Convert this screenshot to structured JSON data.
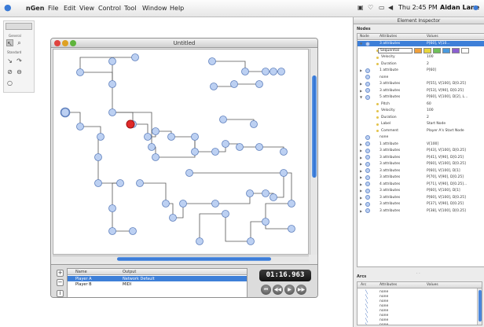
{
  "menubar": {
    "apple_glyph": "",
    "app_name": "nGen",
    "items": [
      "File",
      "Edit",
      "View",
      "Control",
      "Tool",
      "Window",
      "Help"
    ],
    "clock": "Thu 2:45 PM",
    "user": "Aidan Lane"
  },
  "palette": {
    "sections": [
      "General",
      "Standard"
    ]
  },
  "main_window": {
    "title": "Untitled",
    "players_header": [
      "Name",
      "Output"
    ],
    "players": [
      {
        "name": "Player A",
        "output": "Network Default",
        "selected": true
      },
      {
        "name": "Player B",
        "output": "MIDI",
        "selected": false
      }
    ],
    "timer": "01:16.963",
    "transport": [
      "rewind",
      "fast-rewind",
      "play",
      "fast-forward"
    ],
    "add_label": "+",
    "remove_label": "−",
    "info_label": "i"
  },
  "inspector": {
    "title": "Element Inspector",
    "nodes_label": "Nodes",
    "nodes_header": [
      "Node",
      "Attributes",
      "Values"
    ],
    "nodes": [
      {
        "disc": "▼",
        "attr": "3 attributes",
        "value": "P[60], V[10...",
        "selected": true,
        "sub": false
      },
      {
        "disc": "",
        "attr": "Sequential",
        "value": "",
        "selected": false,
        "sub": true,
        "popup": true
      },
      {
        "disc": "",
        "attr": "Velocity",
        "value": "100",
        "selected": false,
        "sub": true
      },
      {
        "disc": "",
        "attr": "Duration",
        "value": "2",
        "selected": false,
        "sub": true
      },
      {
        "disc": "▶",
        "attr": "1 attribute",
        "value": "P[60]",
        "selected": false,
        "sub": false
      },
      {
        "disc": "",
        "attr": "none",
        "value": "",
        "selected": false,
        "sub": false
      },
      {
        "disc": "▶",
        "attr": "3 attributes",
        "value": "P[55], V[100], D[0.25]",
        "selected": false,
        "sub": false
      },
      {
        "disc": "▶",
        "attr": "3 attributes",
        "value": "P[53], V[90], D[0.25]",
        "selected": false,
        "sub": false
      },
      {
        "disc": "▼",
        "attr": "5 attributes",
        "value": "P[60], V[100], D[2], L...",
        "selected": false,
        "sub": false
      },
      {
        "disc": "",
        "attr": "Pitch",
        "value": "60",
        "selected": false,
        "sub": true
      },
      {
        "disc": "",
        "attr": "Velocity",
        "value": "100",
        "selected": false,
        "sub": true
      },
      {
        "disc": "",
        "attr": "Duration",
        "value": "2",
        "selected": false,
        "sub": true
      },
      {
        "disc": "",
        "attr": "Label",
        "value": "Start Node",
        "selected": false,
        "sub": true
      },
      {
        "disc": "",
        "attr": "Comment",
        "value": "Player A's Start Node",
        "selected": false,
        "sub": true
      },
      {
        "disc": "",
        "attr": "none",
        "value": "",
        "selected": false,
        "sub": false
      },
      {
        "disc": "▶",
        "attr": "1 attribute",
        "value": "V[100]",
        "selected": false,
        "sub": false
      },
      {
        "disc": "▶",
        "attr": "3 attributes",
        "value": "P[43], V[100], D[0.25]",
        "selected": false,
        "sub": false
      },
      {
        "disc": "▶",
        "attr": "3 attributes",
        "value": "P[41], V[90], D[0.25]",
        "selected": false,
        "sub": false
      },
      {
        "disc": "▶",
        "attr": "3 attributes",
        "value": "P[60], V[100], D[0.25]",
        "selected": false,
        "sub": false
      },
      {
        "disc": "▶",
        "attr": "3 attributes",
        "value": "P[60], V[100], D[1]",
        "selected": false,
        "sub": false
      },
      {
        "disc": "▶",
        "attr": "3 attributes",
        "value": "P[70], V[90], D[0.25]",
        "selected": false,
        "sub": false
      },
      {
        "disc": "▶",
        "attr": "4 attributes",
        "value": "P[71], V[90], D[0.25]...",
        "selected": false,
        "sub": false
      },
      {
        "disc": "▶",
        "attr": "3 attributes",
        "value": "P[60], V[100], D[1]",
        "selected": false,
        "sub": false
      },
      {
        "disc": "▶",
        "attr": "3 attributes",
        "value": "P[60], V[100], D[0.25]",
        "selected": false,
        "sub": false
      },
      {
        "disc": "▶",
        "attr": "3 attributes",
        "value": "P[37], V[90], D[0.25]",
        "selected": false,
        "sub": false
      },
      {
        "disc": "▶",
        "attr": "3 attributes",
        "value": "P[38], V[100], D[0.25]",
        "selected": false,
        "sub": false
      }
    ],
    "arcs_label": "Arcs",
    "arcs_header": [
      "Arc",
      "Attributes",
      "Values"
    ],
    "arcs": [
      "none",
      "none",
      "none",
      "none",
      "none",
      "none",
      "none",
      "none"
    ],
    "swatch_colors": [
      "#f0a03a",
      "#e7d63b",
      "#6fc05a",
      "#4a9adf",
      "#8b5fd0",
      "#ffffff"
    ],
    "node_color": "#bcd0f2",
    "active_node_color": "#e02a2a",
    "accent": "#3d7fd8"
  }
}
